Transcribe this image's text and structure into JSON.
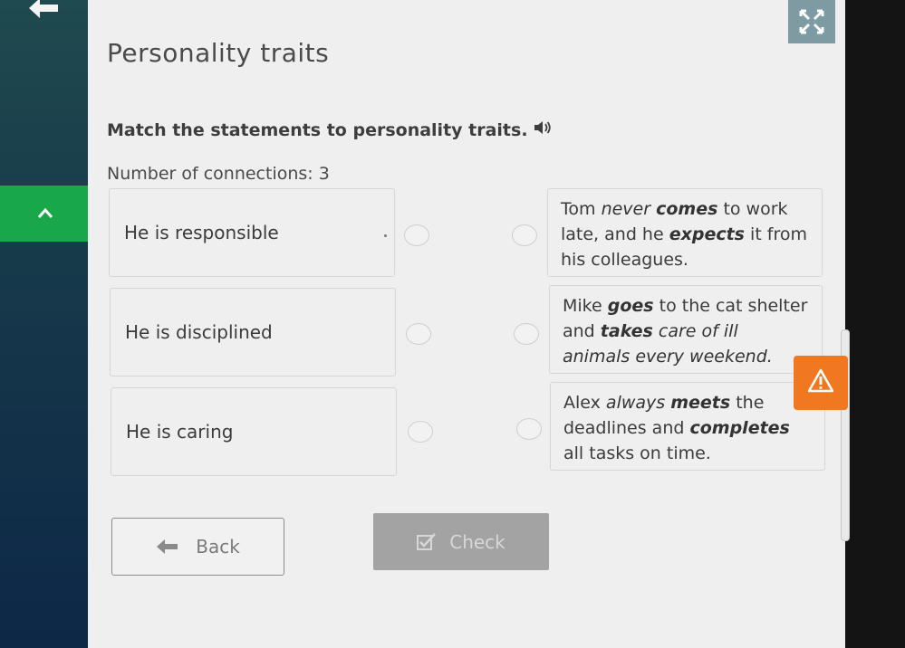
{
  "header": {
    "title": "Personality traits"
  },
  "exercise": {
    "instruction": "Match the statements to personality traits.",
    "connections_label": "Number of connections: 3"
  },
  "traits": [
    {
      "label": "He is responsible"
    },
    {
      "label": "He is disciplined"
    },
    {
      "label": "He is caring"
    }
  ],
  "statements": [
    {
      "parts": [
        "Tom ",
        "never",
        " ",
        "comes",
        " to work late, and he ",
        "expects",
        " it from his colleagues."
      ]
    },
    {
      "parts": [
        "Mike ",
        "goes",
        " to the cat shelter and ",
        "takes",
        " care of ill animals every weekend."
      ]
    },
    {
      "parts": [
        "Alex ",
        "always",
        " ",
        "meets",
        " the deadlines and ",
        "completes",
        " all tasks on time."
      ]
    }
  ],
  "buttons": {
    "back": "Back",
    "check": "Check"
  },
  "colors": {
    "accent_green": "#18a84a",
    "warning_orange": "#f07820",
    "panel_bg": "#efefef"
  },
  "icons": [
    "back-arrow-icon",
    "fullscreen-icon",
    "chevron-up-icon",
    "speaker-icon",
    "warning-icon",
    "checkbox-icon"
  ]
}
